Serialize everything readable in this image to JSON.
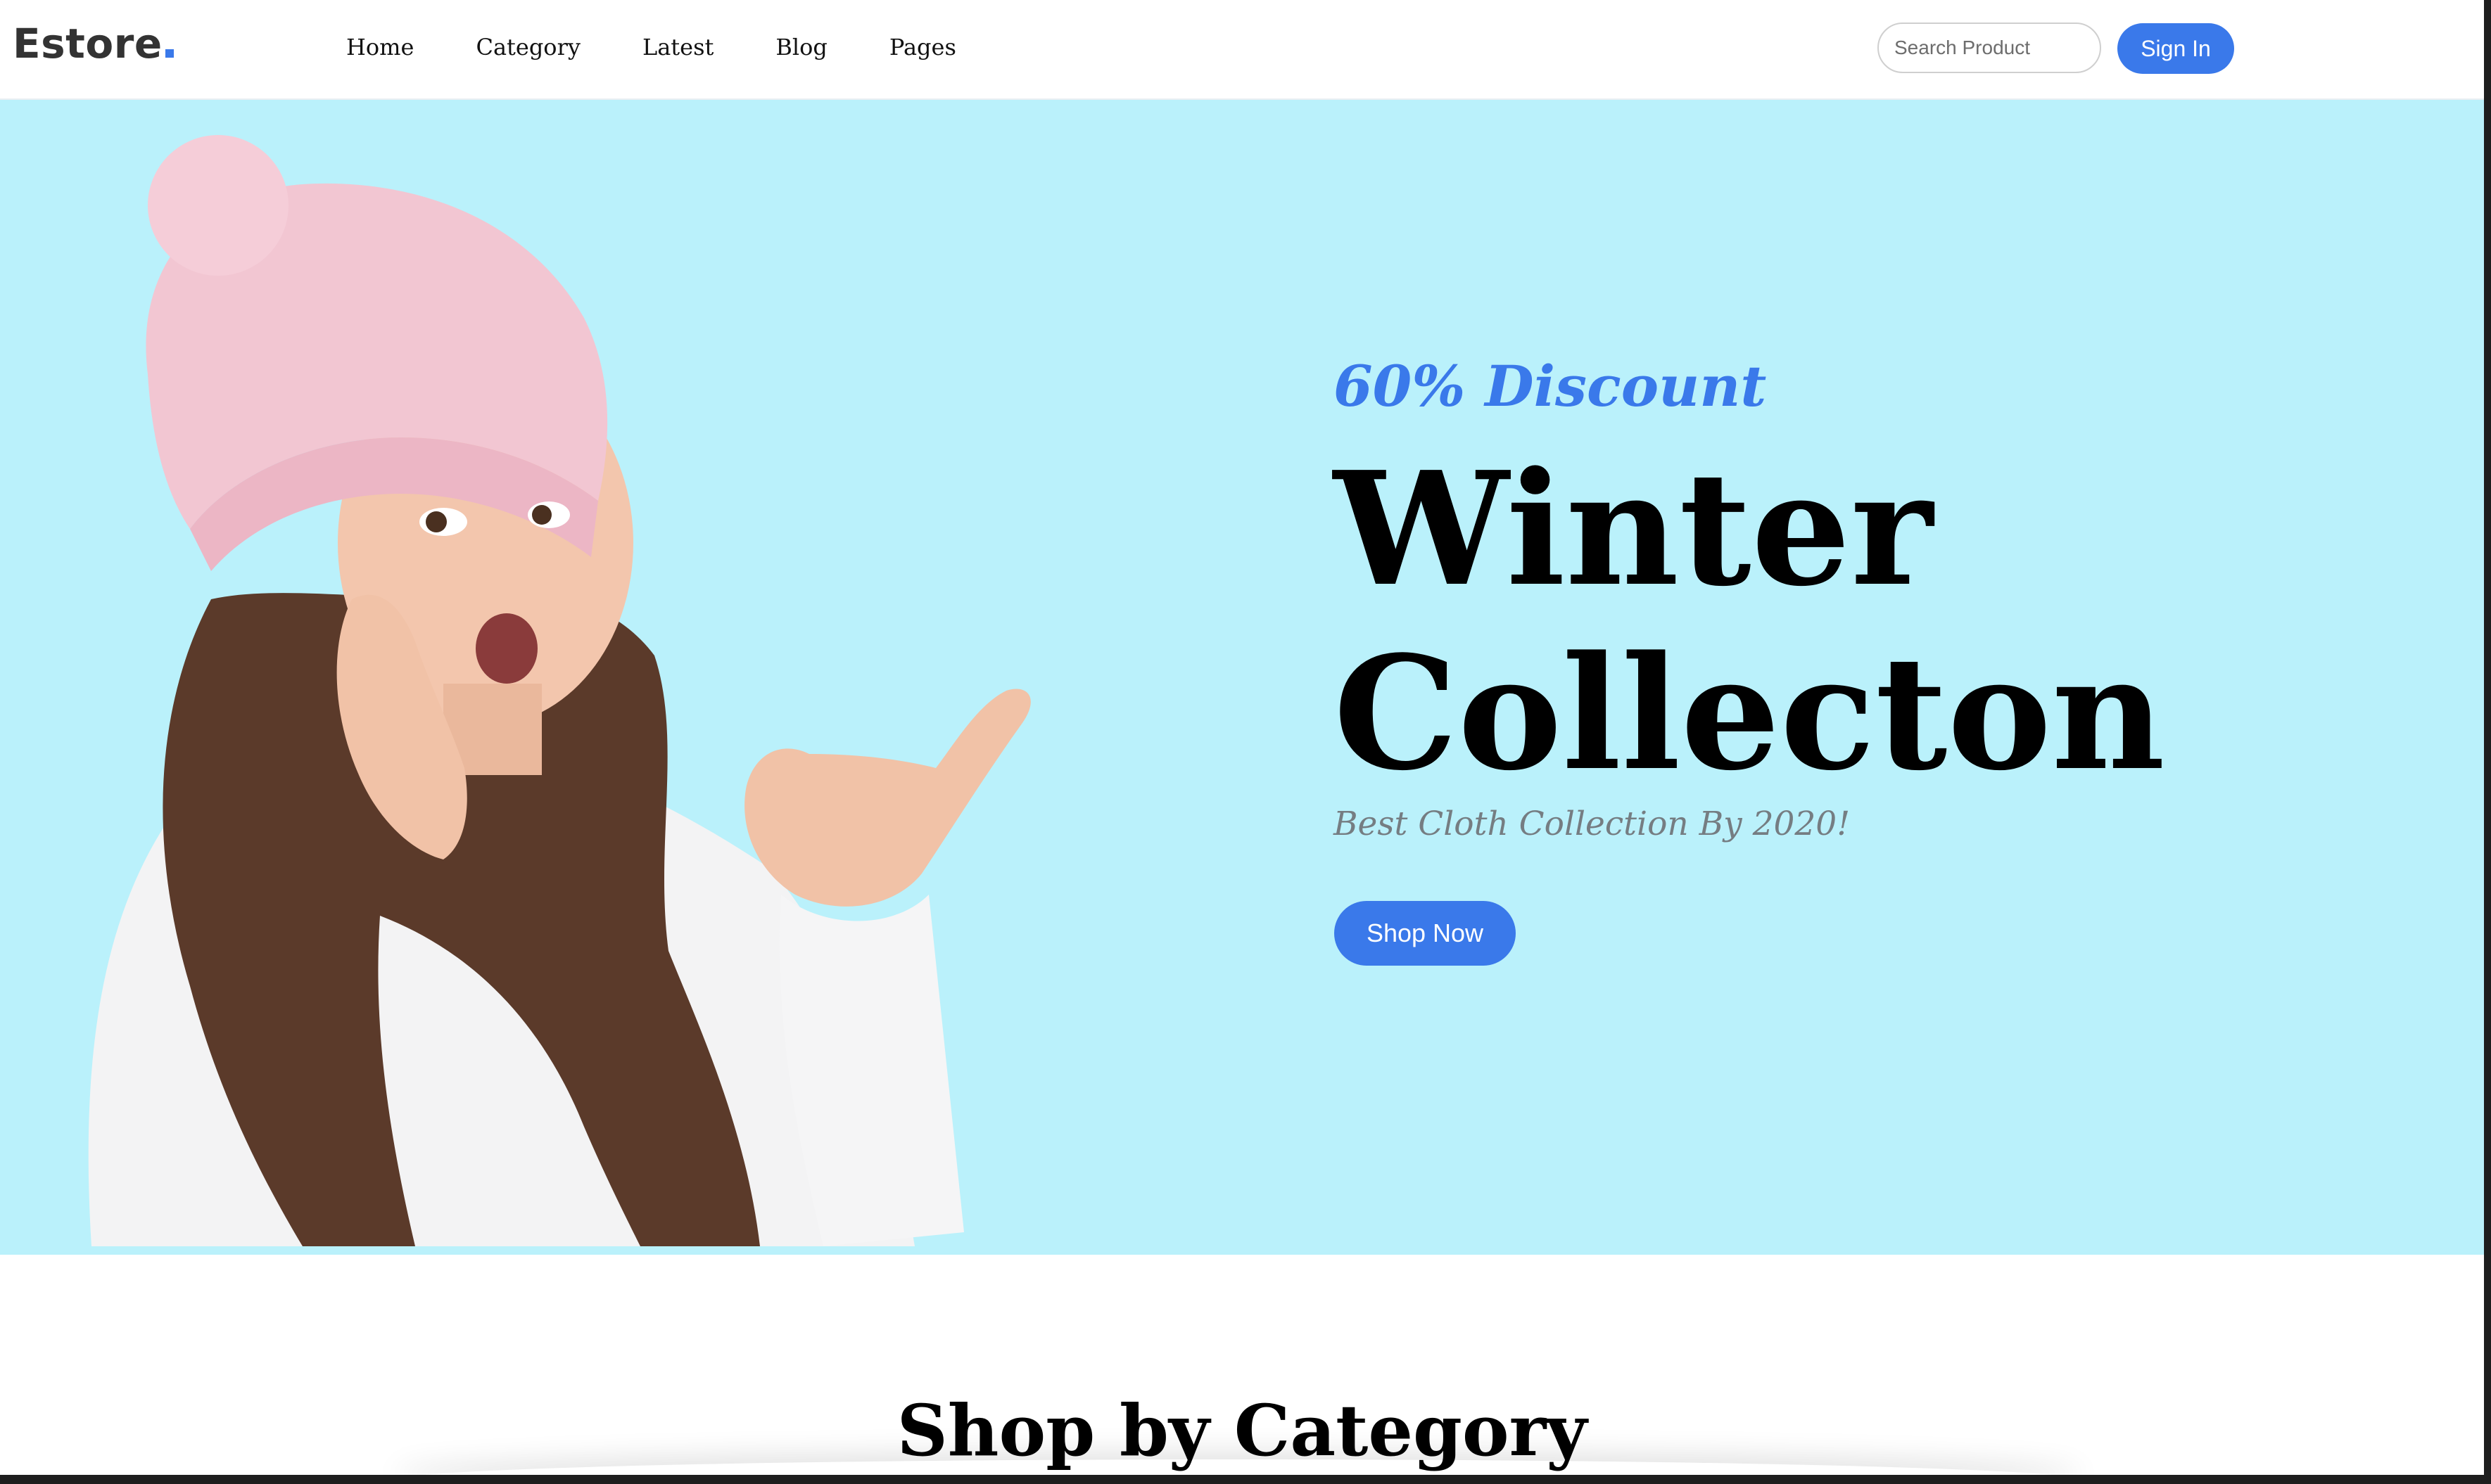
{
  "header": {
    "logo": "Estore",
    "nav": [
      "Home",
      "Category",
      "Latest",
      "Blog",
      "Pages"
    ],
    "search_placeholder": "Search Product",
    "signin_label": "Sign In"
  },
  "hero": {
    "discount": "60% Discount",
    "title_line1": "Winter",
    "title_line2": "Collecton",
    "subtitle": "Best Cloth Collection By 2020!",
    "cta_label": "Shop Now"
  },
  "section": {
    "title": "Shop by Category"
  },
  "colors": {
    "accent": "#3a79ea",
    "hero_bg": "#baf1fb",
    "subtitle": "#757d82"
  }
}
